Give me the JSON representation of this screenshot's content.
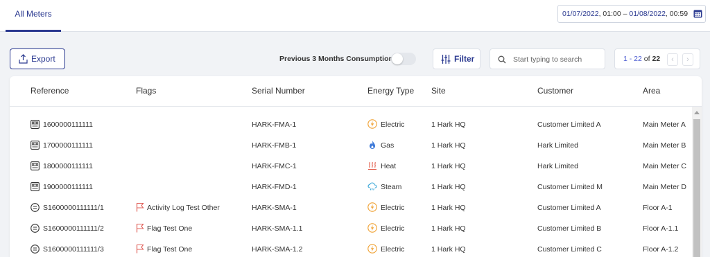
{
  "tabs": [
    {
      "label": "All Meters",
      "active": true
    }
  ],
  "date_range": {
    "start_date": "01/07/2022",
    "start_time": ", 01:00 – ",
    "end_date": "01/08/2022",
    "end_time": ", 00:59"
  },
  "toolbar": {
    "export_label": "Export",
    "prev_consumption_label": "Previous 3 Months Consumption",
    "prev_consumption_on": false,
    "filter_label": "Filter",
    "search_placeholder": "Start typing to search",
    "pager_range": "1 - 22",
    "pager_of": " of ",
    "pager_total": "22"
  },
  "columns": [
    "Reference",
    "Flags",
    "Serial Number",
    "Energy Type",
    "Site",
    "Customer",
    "Area"
  ],
  "rows": [
    {
      "ref": "1600000111111",
      "ref_icon": "meter-icon",
      "flag": "",
      "serial": "HARK-FMA-1",
      "energy": "Electric",
      "energy_icon": "electric-icon",
      "site": "1 Hark HQ",
      "customer": "Customer Limited A",
      "area": "Main Meter A"
    },
    {
      "ref": "1700000111111",
      "ref_icon": "meter-icon",
      "flag": "",
      "serial": "HARK-FMB-1",
      "energy": "Gas",
      "energy_icon": "gas-icon",
      "site": "1 Hark HQ",
      "customer": "Hark Limited",
      "area": "Main Meter B"
    },
    {
      "ref": "1800000111111",
      "ref_icon": "meter-icon",
      "flag": "",
      "serial": "HARK-FMC-1",
      "energy": "Heat",
      "energy_icon": "heat-icon",
      "site": "1 Hark HQ",
      "customer": "Hark Limited",
      "area": "Main Meter C"
    },
    {
      "ref": "1900000111111",
      "ref_icon": "meter-icon",
      "flag": "",
      "serial": "HARK-FMD-1",
      "energy": "Steam",
      "energy_icon": "steam-icon",
      "site": "1 Hark HQ",
      "customer": "Customer Limited M",
      "area": "Main Meter D"
    },
    {
      "ref": "S1600000111111/1",
      "ref_icon": "submeter-icon",
      "flag": "Activity Log Test Other",
      "serial": "HARK-SMA-1",
      "energy": "Electric",
      "energy_icon": "electric-icon",
      "site": "1 Hark HQ",
      "customer": "Customer Limited A",
      "area": "Floor A-1"
    },
    {
      "ref": "S1600000111111/2",
      "ref_icon": "submeter-icon",
      "flag": "Flag Test One",
      "serial": "HARK-SMA-1.1",
      "energy": "Electric",
      "energy_icon": "electric-icon",
      "site": "1 Hark HQ",
      "customer": "Customer Limited B",
      "area": "Floor A-1.1"
    },
    {
      "ref": "S1600000111111/3",
      "ref_icon": "submeter-icon",
      "flag": "Flag Test One",
      "serial": "HARK-SMA-1.2",
      "energy": "Electric",
      "energy_icon": "electric-icon",
      "site": "1 Hark HQ",
      "customer": "Customer Limited C",
      "area": "Floor A-1.2"
    }
  ],
  "colors": {
    "accent": "#2a3990",
    "flag": "#e0605a",
    "electric": "#f0a030",
    "gas": "#3b78d8",
    "heat": "#e25c4a",
    "steam": "#3aa7d8"
  }
}
